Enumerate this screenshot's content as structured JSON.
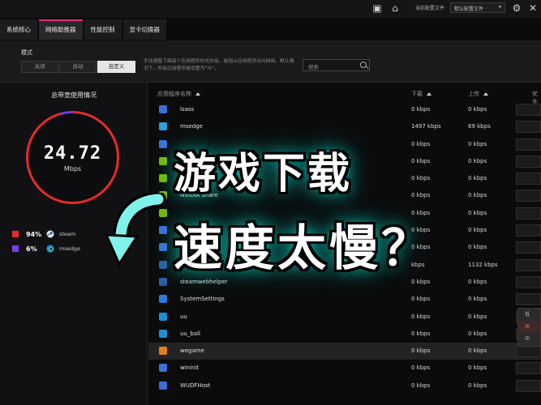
{
  "topbar": {
    "profile_label": "当前配置文件",
    "profile_value": "默认配置文件",
    "icons": [
      "notebook-icon",
      "home-icon",
      "minimize-icon",
      "gamepad-icon",
      "close-icon"
    ]
  },
  "tabs": [
    {
      "label": "系统核心",
      "active": false
    },
    {
      "label": "网络助推器",
      "active": true
    },
    {
      "label": "性能控制",
      "active": false
    },
    {
      "label": "显卡切换器",
      "active": false
    }
  ],
  "mode": {
    "title": "模式",
    "options": [
      "关闭",
      "自动",
      "自定义"
    ],
    "selected": "自定义",
    "description": "手动调整下面每个应用程序的优先级。碰阻止应用程序访问网络。默认情况下，所有应用程序被设置为“中”。",
    "search_placeholder": "搜索"
  },
  "usage": {
    "title": "总带宽使用情况",
    "value": "24.72",
    "unit": "Mbps",
    "legend": [
      {
        "pct": "94%",
        "name": "steam",
        "color": "#e52b2b",
        "icon": "steam-icon"
      },
      {
        "pct": "6%",
        "name": "msedge",
        "color": "#7a3df0",
        "icon": "edge-icon"
      }
    ]
  },
  "table": {
    "headers": {
      "name": "应用程序名称",
      "download": "下载",
      "upload": "上传",
      "priority": "优先"
    },
    "rows": [
      {
        "name": "lsass",
        "download": "0 kbps",
        "upload": "0 kbps",
        "icon_color": "#3d6fd8",
        "highlight": false
      },
      {
        "name": "msedge",
        "download": "1497 kbps",
        "upload": "69 kbps",
        "icon_color": "#2aa0d8",
        "highlight": false
      },
      {
        "name": "",
        "download": "0 kbps",
        "upload": "0 kbps",
        "icon_color": "#3d6fd8",
        "highlight": false
      },
      {
        "name": "",
        "download": "0 kbps",
        "upload": "0 kbps",
        "icon_color": "#76b900",
        "highlight": false
      },
      {
        "name": "",
        "download": "0 kbps",
        "upload": "0 kbps",
        "icon_color": "#76b900",
        "highlight": false
      },
      {
        "name": "NVIDIA Share",
        "download": "0 kbps",
        "upload": "0 kbps",
        "icon_color": "#76b900",
        "highlight": false
      },
      {
        "name": "",
        "download": "0 kbps",
        "upload": "0 kbps",
        "icon_color": "#76b900",
        "highlight": false
      },
      {
        "name": "",
        "download": "0 kbps",
        "upload": "0 kbps",
        "icon_color": "#3d6fd8",
        "highlight": false
      },
      {
        "name": "",
        "download": "0 kbps",
        "upload": "0 kbps",
        "icon_color": "#3d6fd8",
        "highlight": false
      },
      {
        "name": "",
        "download": "kbps",
        "upload": "1132 kbps",
        "icon_color": "#2b5fa8",
        "highlight": false
      },
      {
        "name": "steamwebhelper",
        "download": "0 kbps",
        "upload": "0 kbps",
        "icon_color": "#2b5fa8",
        "highlight": false
      },
      {
        "name": "SystemSettings",
        "download": "0 kbps",
        "upload": "0 kbps",
        "icon_color": "#2d7be0",
        "highlight": false
      },
      {
        "name": "uu",
        "download": "0 kbps",
        "upload": "0 kbps",
        "icon_color": "#1e8fd6",
        "highlight": false
      },
      {
        "name": "uu_ball",
        "download": "0 kbps",
        "upload": "0 kbps",
        "icon_color": "#1e8fd6",
        "highlight": false
      },
      {
        "name": "wegame",
        "download": "0 kbps",
        "upload": "0 kbps",
        "icon_color": "#e8801a",
        "highlight": true
      },
      {
        "name": "wininit",
        "download": "0 kbps",
        "upload": "0 kbps",
        "icon_color": "#3d6fd8",
        "highlight": false
      },
      {
        "name": "WUDFHost",
        "download": "0 kbps",
        "upload": "0 kbps",
        "icon_color": "#3d6fd8",
        "highlight": false
      }
    ]
  },
  "priority_popup": {
    "options": [
      "低",
      "高",
      "中"
    ],
    "selected": "高"
  },
  "overlay": {
    "line1": "游戏下载",
    "line2": "速度太慢？"
  }
}
